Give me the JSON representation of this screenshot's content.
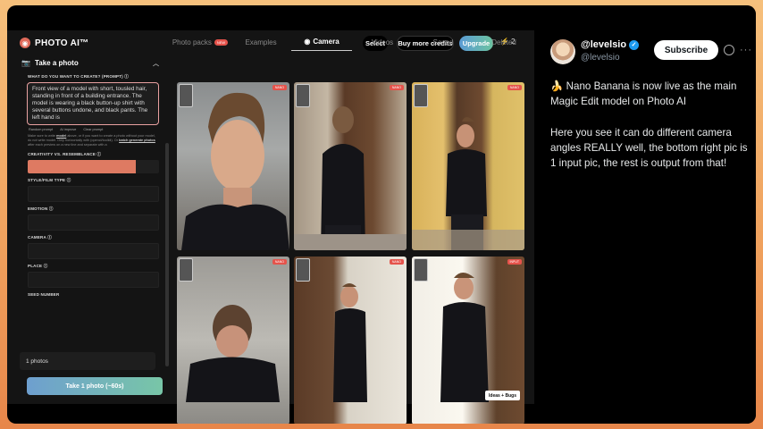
{
  "app": {
    "logo_text": "PHOTO AI™",
    "topbar": {
      "select_label": "Select",
      "credits_label": "Buy more credits",
      "upgrade_label": "Upgrade",
      "credit_count": "2"
    },
    "sidebar": {
      "section_title": "Take a photo",
      "prompt_label": "WHAT DO YOU WANT TO CREATE? (PROMPT) ⓘ",
      "prompt_value": "Front view of a model with short, tousled hair, standing in front of a building entrance. The model is wearing a black button-up shirt with several buttons undone, and black pants. The left hand is",
      "prompt_actions": [
        "Random prompt",
        "AI improve",
        "Clear prompt"
      ],
      "creativity_label": "CREATIVITY VS. RESEMBLANCE ⓘ",
      "creativity_level": 0.82,
      "style_label": "STYLE/FILM TYPE ⓘ",
      "emotion_label": "EMOTION ⓘ",
      "camera_label": "CAMERA ⓘ",
      "place_label": "PLACE ⓘ",
      "seed_label": "SEED NUMBER",
      "photos_value": "1 photos",
      "generate_label": "Take 1 photo (~60s)"
    },
    "tabs": [
      {
        "label": "Photo packs",
        "badge": "NEW"
      },
      {
        "label": "Examples"
      },
      {
        "label": "Camera",
        "active": true
      },
      {
        "label": "Videos"
      },
      {
        "label": "Saved"
      },
      {
        "label": "Deleted"
      }
    ],
    "ideas_label": "Ideas + Bugs"
  },
  "tweet": {
    "name": "@levelsio",
    "handle": "@levelsio",
    "subscribe_label": "Subscribe",
    "paragraphs": [
      "🍌 Nano Banana is now live as the main Magic Edit model on Photo AI",
      "Here you see it can do different camera angles REALLY well, the bottom right pic is 1 input pic, the rest is output from that!"
    ]
  },
  "colors": {
    "accent_coral": "#de7a62",
    "upgrade_gradient_start": "#5b9bd5",
    "upgrade_gradient_end": "#6cc4a0",
    "x_verified": "#1d9bf0",
    "badge_red": "#e5534b"
  }
}
